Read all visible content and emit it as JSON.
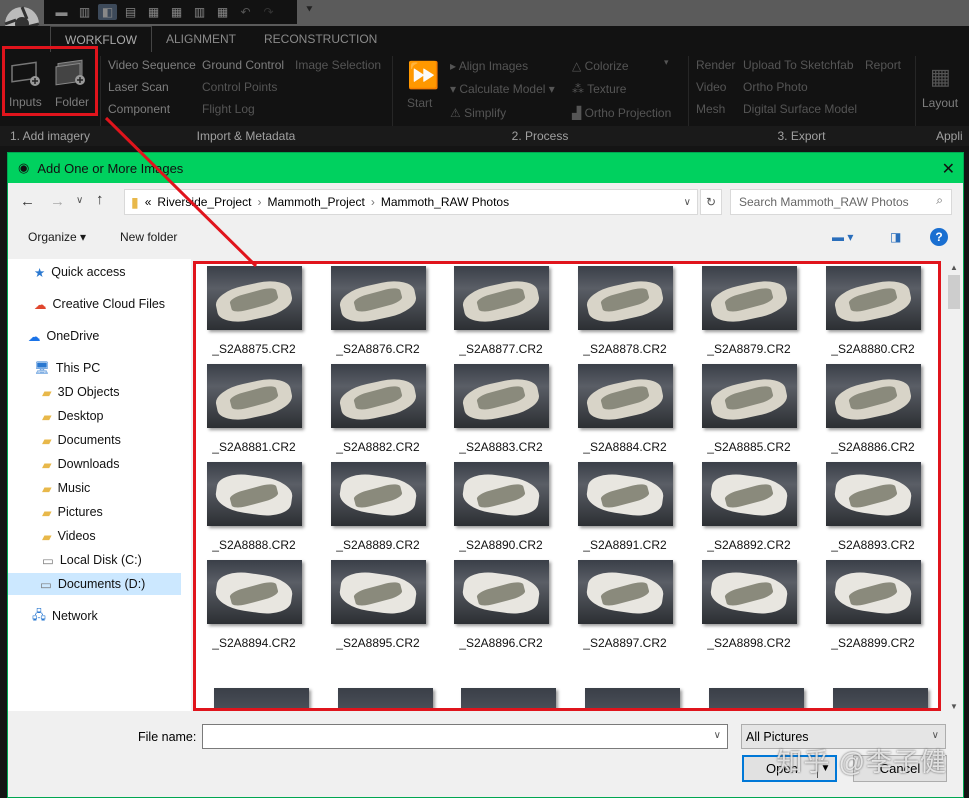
{
  "app": {
    "quick_toolbar": [
      "layout-1",
      "layout-2",
      "layout-3",
      "layout-4",
      "layout-5",
      "layout-6",
      "layout-7",
      "layout-8",
      "undo",
      "redo"
    ],
    "tabs": [
      {
        "label": "WORKFLOW",
        "active": true
      },
      {
        "label": "ALIGNMENT"
      },
      {
        "label": "RECONSTRUCTION"
      }
    ],
    "ribbon": {
      "add_imagery": {
        "inputs": "Inputs",
        "folder": "Folder",
        "label": "1. Add imagery"
      },
      "import": {
        "items": [
          "Video Sequence",
          "Ground Control",
          "Image Selection",
          "Laser Scan",
          "Control Points",
          "Component",
          "Flight Log"
        ],
        "label": "Import & Metadata"
      },
      "process": {
        "start": "Start",
        "items": [
          "Align Images",
          "Colorize",
          "Calculate Model",
          "Texture",
          "Simplify",
          "Ortho Projection"
        ],
        "label": "2. Process"
      },
      "export": {
        "items": [
          "Render",
          "Upload To Sketchfab",
          "Report",
          "Video",
          "Ortho Photo",
          "Mesh",
          "Digital Surface Model"
        ],
        "label": "3. Export"
      },
      "layout": {
        "label": "Layout",
        "group": "Appli"
      }
    }
  },
  "dialog": {
    "title": "Add One or More Images",
    "breadcrumb": [
      "«",
      "Riverside_Project",
      "Mammoth_Project",
      "Mammoth_RAW Photos"
    ],
    "search_placeholder": "Search Mammoth_RAW Photos",
    "organize": "Organize ▾",
    "new_folder": "New folder",
    "nav": [
      {
        "label": "Quick access",
        "icon": "★"
      },
      {
        "label": "Creative Cloud Files",
        "icon": "☁"
      },
      {
        "label": "OneDrive",
        "icon": "☁"
      },
      {
        "label": "This PC",
        "icon": "🖥"
      },
      {
        "label": "3D Objects",
        "icon": "▰"
      },
      {
        "label": "Desktop",
        "icon": "▰"
      },
      {
        "label": "Documents",
        "icon": "▰"
      },
      {
        "label": "Downloads",
        "icon": "▰"
      },
      {
        "label": "Music",
        "icon": "▰"
      },
      {
        "label": "Pictures",
        "icon": "▰"
      },
      {
        "label": "Videos",
        "icon": "▰"
      },
      {
        "label": "Local Disk (C:)",
        "icon": "▭"
      },
      {
        "label": "Documents (D:)",
        "icon": "▭",
        "selected": true
      },
      {
        "label": "Network",
        "icon": "🖧"
      }
    ],
    "files": [
      "_S2A8875.CR2",
      "_S2A8876.CR2",
      "_S2A8877.CR2",
      "_S2A8878.CR2",
      "_S2A8879.CR2",
      "_S2A8880.CR2",
      "_S2A8881.CR2",
      "_S2A8882.CR2",
      "_S2A8883.CR2",
      "_S2A8884.CR2",
      "_S2A8885.CR2",
      "_S2A8886.CR2",
      "_S2A8888.CR2",
      "_S2A8889.CR2",
      "_S2A8890.CR2",
      "_S2A8891.CR2",
      "_S2A8892.CR2",
      "_S2A8893.CR2",
      "_S2A8894.CR2",
      "_S2A8895.CR2",
      "_S2A8896.CR2",
      "_S2A8897.CR2",
      "_S2A8898.CR2",
      "_S2A8899.CR2"
    ],
    "file_name_label": "File name:",
    "file_name_value": "",
    "filter": "All Pictures",
    "open": "Open",
    "cancel": "Cancel"
  },
  "watermark": "知乎 @李子健",
  "colors": {
    "annotation": "#e0141c",
    "title_bar": "#00d15f"
  }
}
